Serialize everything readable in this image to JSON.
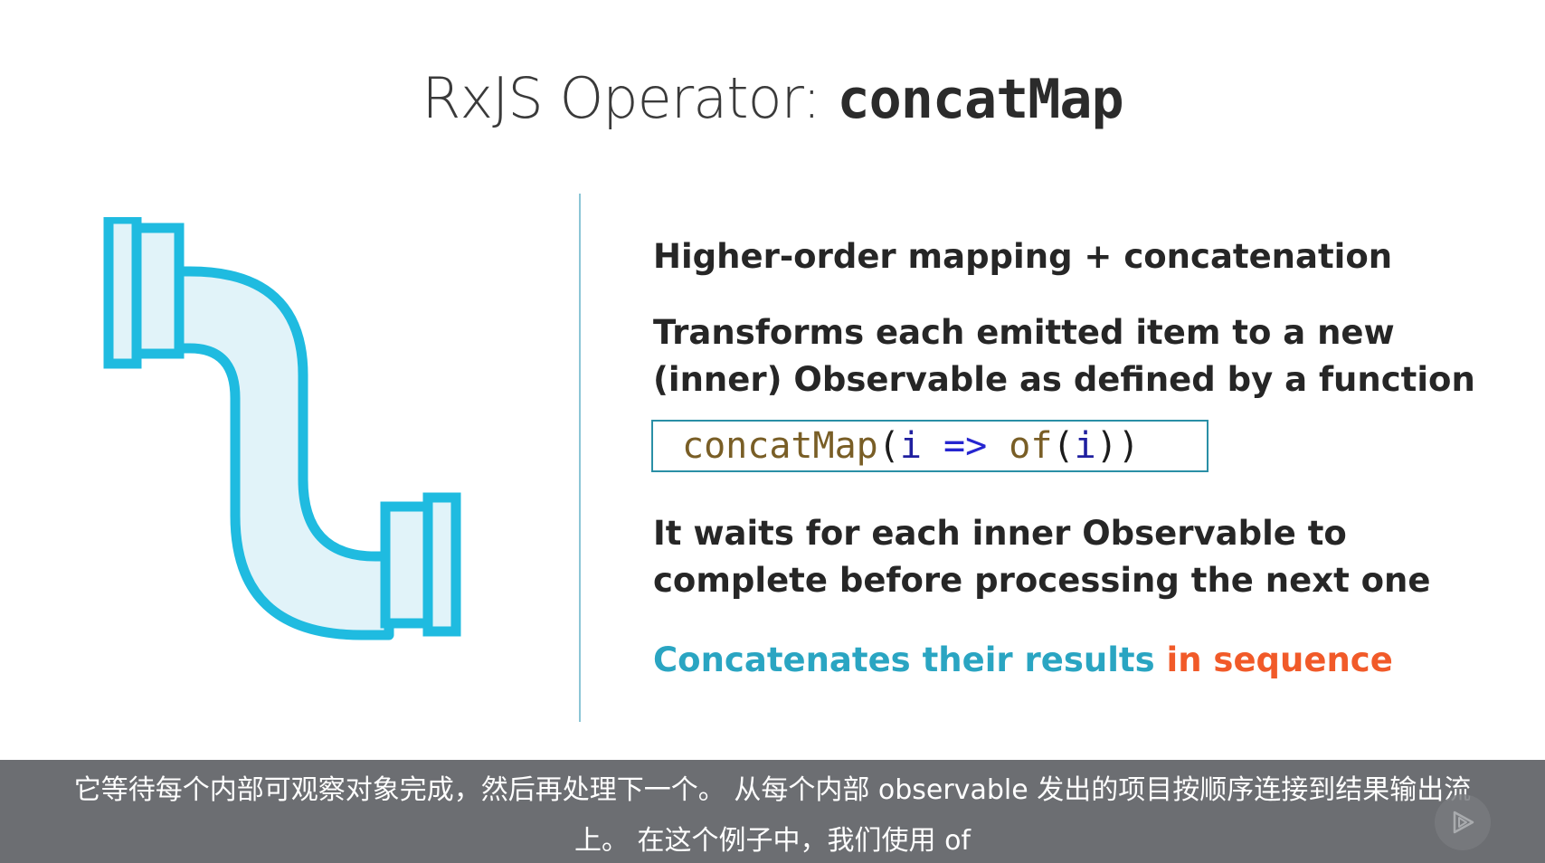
{
  "slide": {
    "title_prefix": "RxJS Operator: ",
    "title_code": "concatMap",
    "point1": "Higher-order mapping + concatenation",
    "point2_line1": "Transforms each emitted item to a new",
    "point2_line2": "(inner) Observable as defined by a function",
    "code": {
      "fn": "concatMap",
      "open1": "(",
      "arg": "i",
      "arrow": "=>",
      "fn2": "of",
      "open2": "(",
      "arg2": "i",
      "close": "))"
    },
    "point3_line1": "It waits for each inner Observable to",
    "point3_line2": "complete before processing the next one",
    "point4_main": "Concatenates their results ",
    "point4_highlight": "in sequence",
    "colors": {
      "accent_teal": "#2aa5c2",
      "accent_orange": "#f15a29",
      "pipe_stroke": "#1fbbe0",
      "pipe_fill": "#e1f3f9"
    },
    "icons": {
      "illustration": "pipe-icon",
      "player": "play-icon"
    }
  },
  "captions": {
    "line1": "它等待每个内部可观察对象完成，然后再处理下一个。 从每个内部 observable 发出的项目按顺序连接到结果输出流",
    "line2": "上。 在这个例子中，我们使用 of"
  }
}
